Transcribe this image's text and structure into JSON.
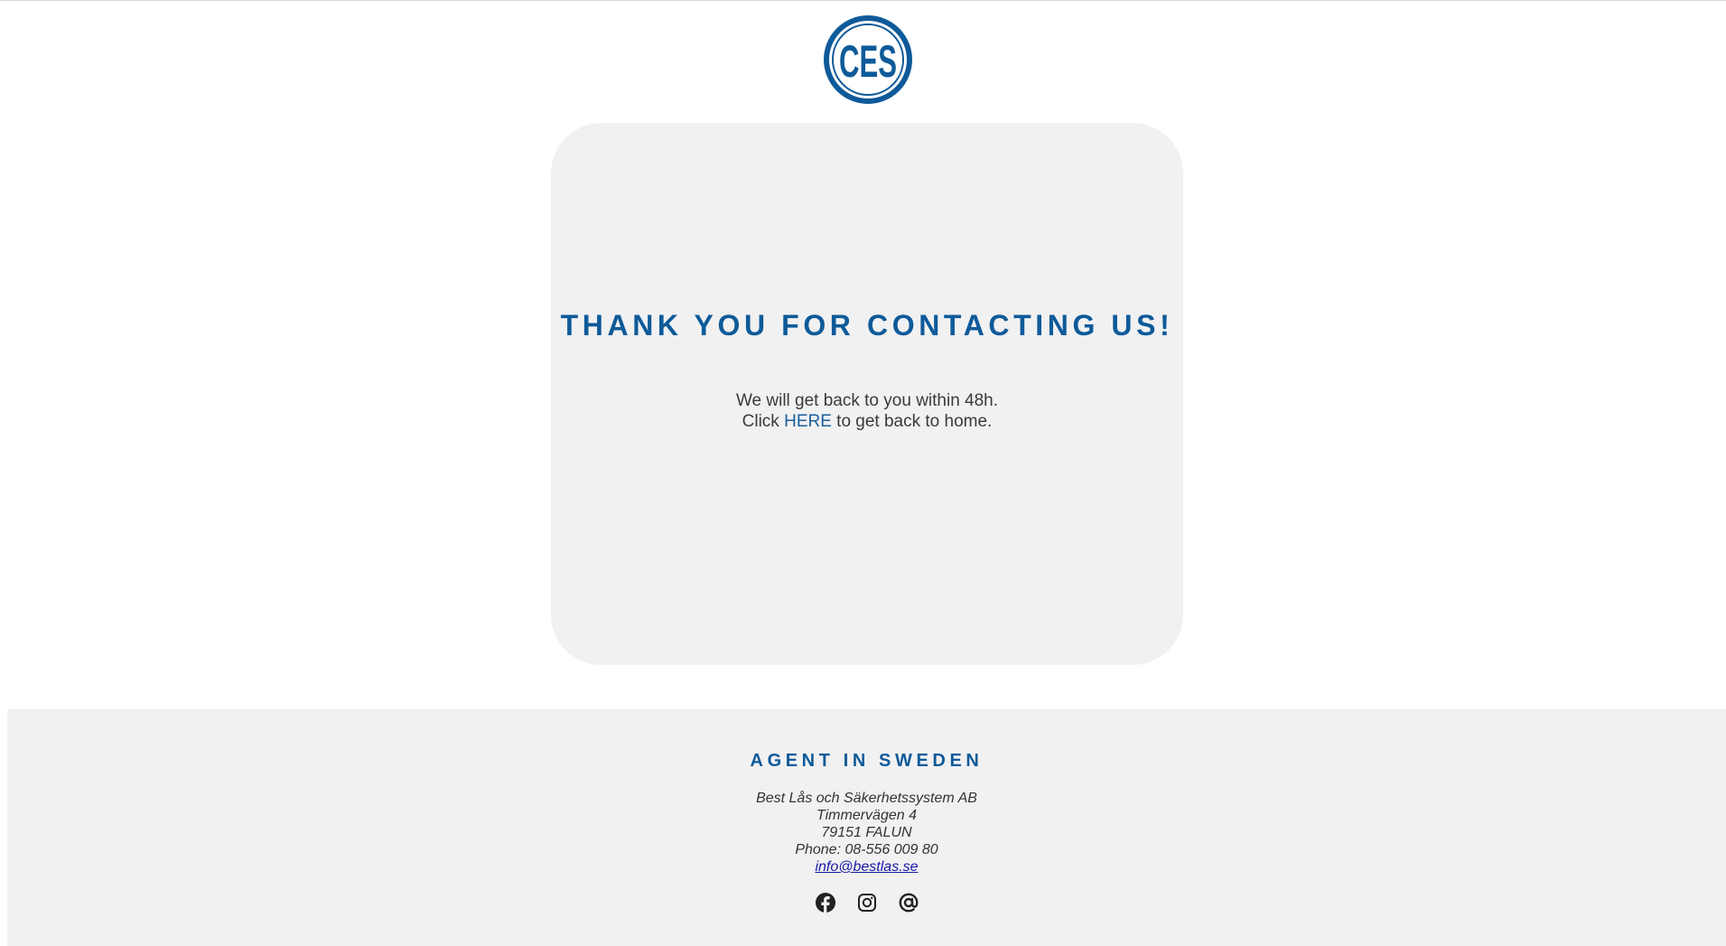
{
  "logo": {
    "brand_color": "#0e5a99",
    "icon": "ces-logo"
  },
  "confirmation": {
    "title": "THANK YOU FOR CONTACTING US!",
    "line1": "We will get back to you within 48h.",
    "line2_prefix": "Click",
    "link_text": "HERE",
    "line2_suffix": "to get back to home."
  },
  "footer": {
    "title": "AGENT IN SWEDEN",
    "company": "Best Lås och Säkerhetssystem AB",
    "street": "Timmervägen 4",
    "city": "79151 FALUN",
    "phone": "Phone: 08-556 009 80",
    "email": "info@bestlas.se",
    "social_icons": [
      "facebook-icon",
      "instagram-icon",
      "at-sign-icon"
    ]
  },
  "colors": {
    "accent": "#0e5a99",
    "card_bg": "#f1f1f2",
    "text": "#3a3a3a",
    "email_link": "#1a1aa6"
  }
}
